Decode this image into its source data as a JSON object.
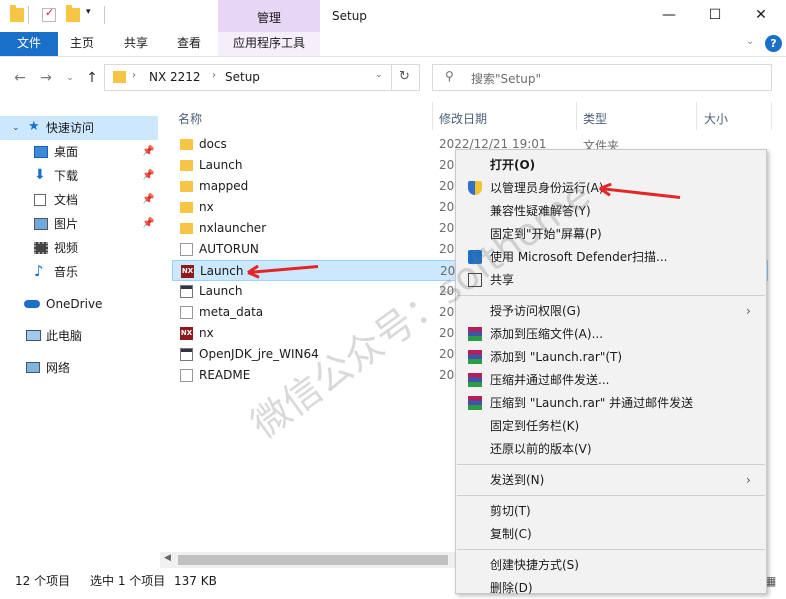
{
  "window": {
    "title": "Setup",
    "manage_label": "管理",
    "minimize": "—",
    "maximize": "☐",
    "close": "✕"
  },
  "ribbon": {
    "tabs": [
      "文件",
      "主页",
      "共享",
      "查看",
      "应用程序工具"
    ],
    "help": "?"
  },
  "address": {
    "breadcrumb": [
      "NX 2212",
      "Setup"
    ],
    "search_placeholder": "搜索\"Setup\""
  },
  "columns": {
    "name": "名称",
    "date": "修改日期",
    "type": "类型",
    "size": "大小"
  },
  "nav": {
    "quick_access": "快速访问",
    "items": [
      "桌面",
      "下载",
      "文档",
      "图片",
      "视频",
      "音乐"
    ],
    "onedrive": "OneDrive",
    "this_pc": "此电脑",
    "network": "网络"
  },
  "files": [
    {
      "name": "docs",
      "date": "2022/12/21 19:01",
      "type": "文件夹",
      "icon": "folder"
    },
    {
      "name": "Launch",
      "date": "202",
      "type": "",
      "icon": "folder"
    },
    {
      "name": "mapped",
      "date": "202",
      "type": "",
      "icon": "folder"
    },
    {
      "name": "nx",
      "date": "202",
      "type": "",
      "icon": "folder"
    },
    {
      "name": "nxlauncher",
      "date": "202",
      "type": "",
      "icon": "folder"
    },
    {
      "name": "AUTORUN",
      "date": "202",
      "type": "",
      "icon": "file"
    },
    {
      "name": "Launch",
      "date": "202",
      "type": "",
      "icon": "nx"
    },
    {
      "name": "Launch",
      "date": "202",
      "type": "",
      "icon": "app"
    },
    {
      "name": "meta_data",
      "date": "202",
      "type": "",
      "icon": "file"
    },
    {
      "name": "nx",
      "date": "202",
      "type": "",
      "icon": "nx"
    },
    {
      "name": "OpenJDK_jre_WIN64",
      "date": "202",
      "type": "",
      "icon": "app"
    },
    {
      "name": "README",
      "date": "202",
      "type": "",
      "icon": "text"
    }
  ],
  "nx_icon_text": "NX",
  "context_menu": {
    "items": [
      {
        "label": "打开(O)",
        "bold": true
      },
      {
        "label": "以管理员身份运行(A)"
      },
      {
        "label": "兼容性疑难解答(Y)"
      },
      {
        "label": "固定到\"开始\"屏幕(P)"
      },
      {
        "label": "使用 Microsoft Defender扫描..."
      },
      {
        "label": "共享"
      },
      {
        "label": "授予访问权限(G)"
      },
      {
        "label": "添加到压缩文件(A)..."
      },
      {
        "label": "添加到 \"Launch.rar\"(T)"
      },
      {
        "label": "压缩并通过邮件发送..."
      },
      {
        "label": "压缩到 \"Launch.rar\" 并通过邮件发送"
      },
      {
        "label": "固定到任务栏(K)"
      },
      {
        "label": "还原以前的版本(V)"
      },
      {
        "label": "发送到(N)"
      },
      {
        "label": "剪切(T)"
      },
      {
        "label": "复制(C)"
      },
      {
        "label": "创建快捷方式(S)"
      },
      {
        "label": "删除(D)"
      }
    ]
  },
  "status": {
    "count": "12 个项目",
    "selected": "选中 1 个项目",
    "size": "137 KB"
  },
  "watermark": "微信公众号：softhome",
  "colors": {
    "accent": "#1a6fc9",
    "manage_tab": "#e8d6f5",
    "selection": "#cce8ff",
    "annotation": "#e32626"
  }
}
